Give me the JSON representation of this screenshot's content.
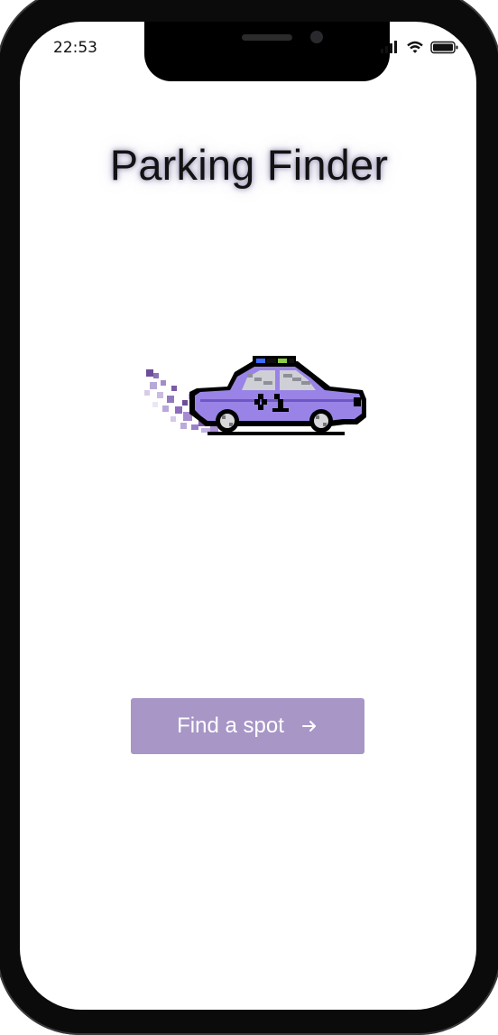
{
  "status_bar": {
    "time": "22:53",
    "icons": [
      "cellular-signal-icon",
      "wifi-icon",
      "battery-icon"
    ]
  },
  "app": {
    "title": "Parking Finder",
    "illustration": "pixel-taxi-car-icon"
  },
  "primary_action": {
    "label": "Find a spot",
    "icon": "arrow-right-icon"
  },
  "colors": {
    "accent": "#a796c6",
    "car_body": "#9a83e6",
    "car_outline": "#000000",
    "exhaust": "#7b5aa6"
  }
}
